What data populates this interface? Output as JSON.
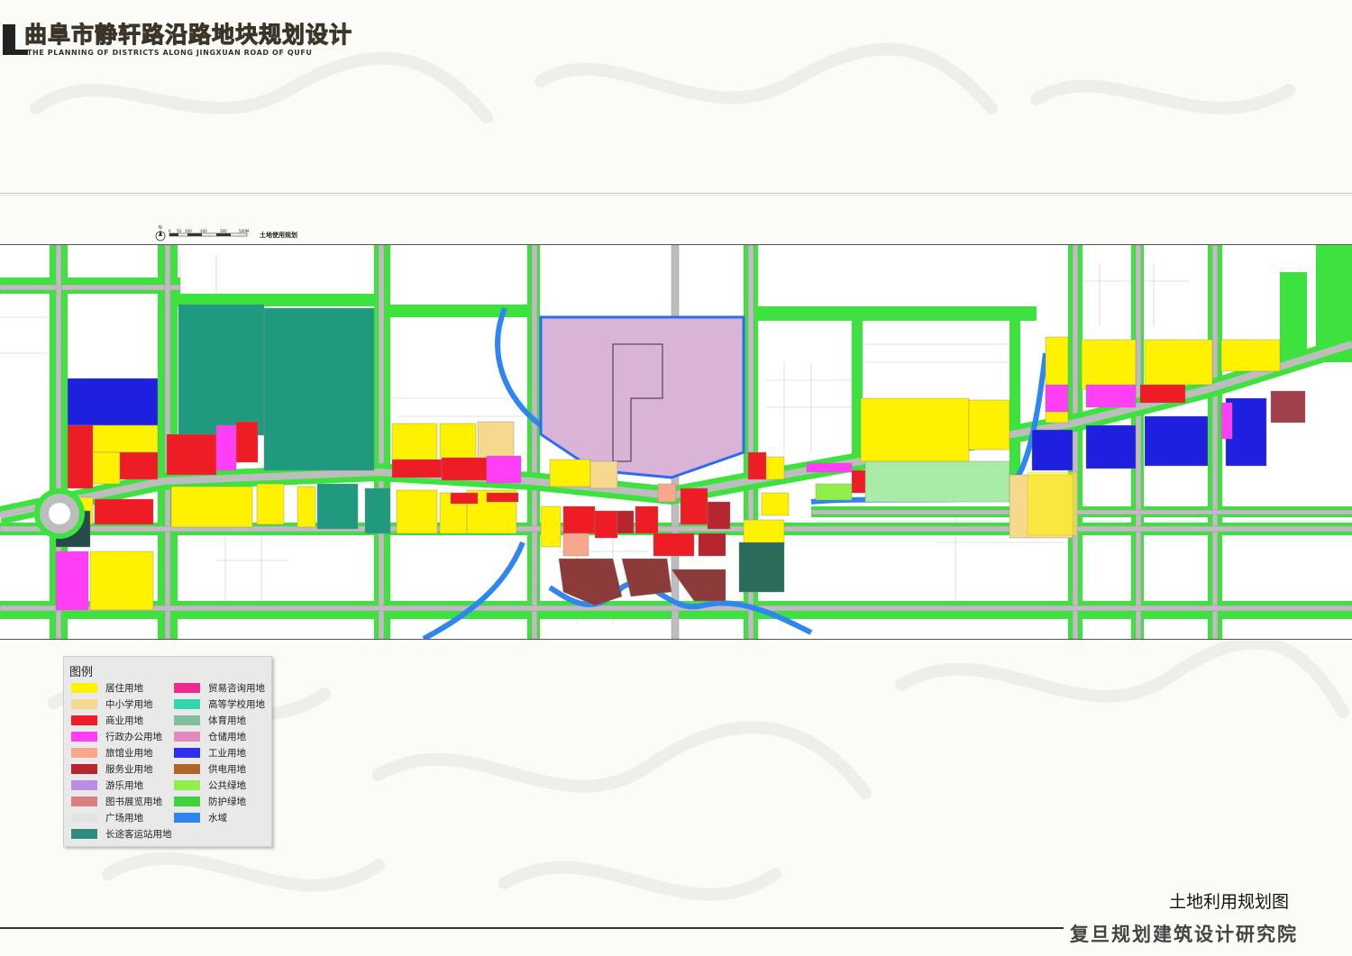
{
  "header": {
    "title": "曲阜市静轩路沿路地块规划设计",
    "subtitle": "THE PLANNING OF DISTRICTS ALONG JINGXUAN ROAD OF QUFU"
  },
  "map": {
    "label": "土地使用规划",
    "north": "N",
    "scale_ticks": [
      "0",
      "50",
      "100",
      "200",
      "300",
      "500M"
    ]
  },
  "legend": {
    "title": "图例",
    "items": [
      {
        "label": "居住用地",
        "color": "#fff200"
      },
      {
        "label": "中小学用地",
        "color": "#f6d98c"
      },
      {
        "label": "商业用地",
        "color": "#ee1c25"
      },
      {
        "label": "行政办公用地",
        "color": "#ff3ef5"
      },
      {
        "label": "旅馆业用地",
        "color": "#f7a88c"
      },
      {
        "label": "服务业用地",
        "color": "#b5262f"
      },
      {
        "label": "游乐用地",
        "color": "#b98ee0"
      },
      {
        "label": "图书展览用地",
        "color": "#d88080"
      },
      {
        "label": "广场用地",
        "color": "#e4e4e4"
      },
      {
        "label": "长途客运站用地",
        "color": "#2f8b7e"
      },
      {
        "label": "贸易咨询用地",
        "color": "#ef2a8e"
      },
      {
        "label": "高等学校用地",
        "color": "#2fd6b0"
      },
      {
        "label": "体育用地",
        "color": "#7fbf9e"
      },
      {
        "label": "仓储用地",
        "color": "#e28ac0"
      },
      {
        "label": "工业用地",
        "color": "#2e2ef0"
      },
      {
        "label": "供电用地",
        "color": "#b0642a"
      },
      {
        "label": "公共绿地",
        "color": "#8ff04a"
      },
      {
        "label": "防护绿地",
        "color": "#3fd23f"
      },
      {
        "label": "水域",
        "color": "#2f86f0"
      }
    ]
  },
  "footer": {
    "caption": "土地利用规划图",
    "institute": "复旦规划建筑设计研究院"
  }
}
